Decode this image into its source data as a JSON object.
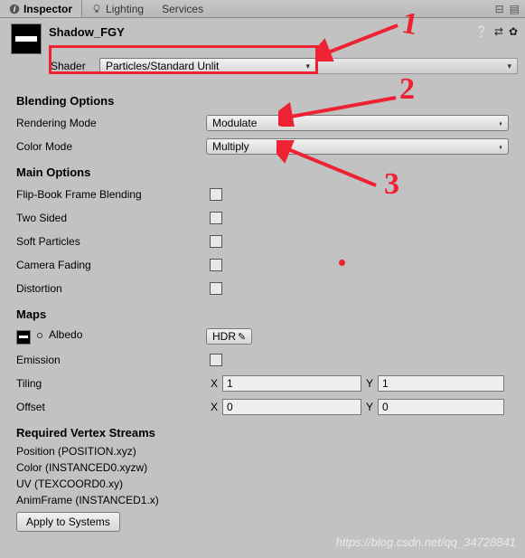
{
  "tabs": {
    "inspector": "Inspector",
    "lighting": "Lighting",
    "services": "Services"
  },
  "material": {
    "name": "Shadow_FGY",
    "shader_label": "Shader",
    "shader_value": "Particles/Standard Unlit"
  },
  "blending": {
    "heading": "Blending Options",
    "rendering_mode_label": "Rendering Mode",
    "rendering_mode_value": "Modulate",
    "color_mode_label": "Color Mode",
    "color_mode_value": "Multiply"
  },
  "main": {
    "heading": "Main Options",
    "flipbook": "Flip-Book Frame Blending",
    "two_sided": "Two Sided",
    "soft_particles": "Soft Particles",
    "camera_fading": "Camera Fading",
    "distortion": "Distortion"
  },
  "maps": {
    "heading": "Maps",
    "albedo": "Albedo",
    "hdr": "HDR",
    "emission": "Emission",
    "tiling": "Tiling",
    "tiling_x": "1",
    "tiling_y": "1",
    "x_label": "X",
    "y_label": "Y",
    "offset": "Offset",
    "offset_x": "0",
    "offset_y": "0"
  },
  "streams": {
    "heading": "Required Vertex Streams",
    "position": "Position (POSITION.xyz)",
    "color": "Color (INSTANCED0.xyzw)",
    "uv": "UV (TEXCOORD0.xy)",
    "animframe": "AnimFrame (INSTANCED1.x)",
    "apply": "Apply to Systems"
  },
  "annotations": {
    "a1": "1",
    "a2": "2",
    "a3": "3"
  },
  "watermark": "https://blog.csdn.net/qq_34728841"
}
